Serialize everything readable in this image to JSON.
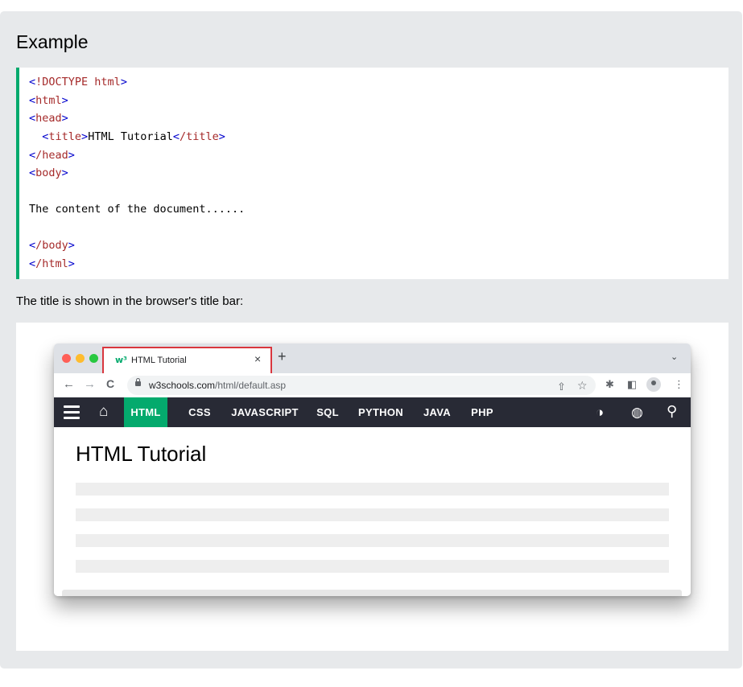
{
  "example": {
    "title": "Example",
    "code_lines": [
      [
        {
          "t": "<",
          "c": "brk"
        },
        {
          "t": "!DOCTYPE",
          "c": "tagname"
        },
        {
          "t": " html",
          "c": "tagname"
        },
        {
          "t": ">",
          "c": "brk"
        }
      ],
      [
        {
          "t": "<",
          "c": "brk"
        },
        {
          "t": "html",
          "c": "tagname"
        },
        {
          "t": ">",
          "c": "brk"
        }
      ],
      [
        {
          "t": "<",
          "c": "brk"
        },
        {
          "t": "head",
          "c": "tagname"
        },
        {
          "t": ">",
          "c": "brk"
        }
      ],
      [
        {
          "t": "  ",
          "c": "txt"
        },
        {
          "t": "<",
          "c": "brk"
        },
        {
          "t": "title",
          "c": "tagname"
        },
        {
          "t": ">",
          "c": "brk"
        },
        {
          "t": "HTML Tutorial",
          "c": "txt"
        },
        {
          "t": "<",
          "c": "brk"
        },
        {
          "t": "/title",
          "c": "tagname"
        },
        {
          "t": ">",
          "c": "brk"
        }
      ],
      [
        {
          "t": "<",
          "c": "brk"
        },
        {
          "t": "/head",
          "c": "tagname"
        },
        {
          "t": ">",
          "c": "brk"
        }
      ],
      [
        {
          "t": "<",
          "c": "brk"
        },
        {
          "t": "body",
          "c": "tagname"
        },
        {
          "t": ">",
          "c": "brk"
        }
      ],
      [],
      [
        {
          "t": "The content of the document......",
          "c": "txt"
        }
      ],
      [],
      [
        {
          "t": "<",
          "c": "brk"
        },
        {
          "t": "/body",
          "c": "tagname"
        },
        {
          "t": ">",
          "c": "brk"
        }
      ],
      [
        {
          "t": "<",
          "c": "brk"
        },
        {
          "t": "/html",
          "c": "tagname"
        },
        {
          "t": ">",
          "c": "brk"
        }
      ]
    ],
    "caption": "The title is shown in the browser's title bar:"
  },
  "browser": {
    "tab": {
      "icon": "w³",
      "title": "HTML Tutorial",
      "close": "×"
    },
    "new_tab": "+",
    "tab_dropdown": "⌄",
    "nav": {
      "back": "←",
      "forward": "→",
      "reload": "C"
    },
    "url_domain": "w3schools.com",
    "url_path": "/html/default.asp",
    "toolbar_icons": {
      "share": "⇧",
      "star": "☆",
      "extensions": "✱",
      "sidepanel": "◧",
      "menu": "⋮"
    },
    "site_nav": {
      "home": "⌂",
      "items": [
        "HTML",
        "CSS",
        "JAVASCRIPT",
        "SQL",
        "PYTHON",
        "JAVA",
        "PHP"
      ],
      "active_item": "HTML",
      "right_icons": {
        "contrast": "◑",
        "globe": "◍",
        "search": "⚲"
      }
    },
    "page_heading": "HTML Tutorial",
    "placeholder_lines": 4
  },
  "colors": {
    "accent": "#04aa6d",
    "navbar": "#282a35",
    "tab_highlight": "#d9363e",
    "tag_name": "#a52a2a",
    "tag_bracket": "#0000cd",
    "panel_bg": "#e7e9eb"
  }
}
